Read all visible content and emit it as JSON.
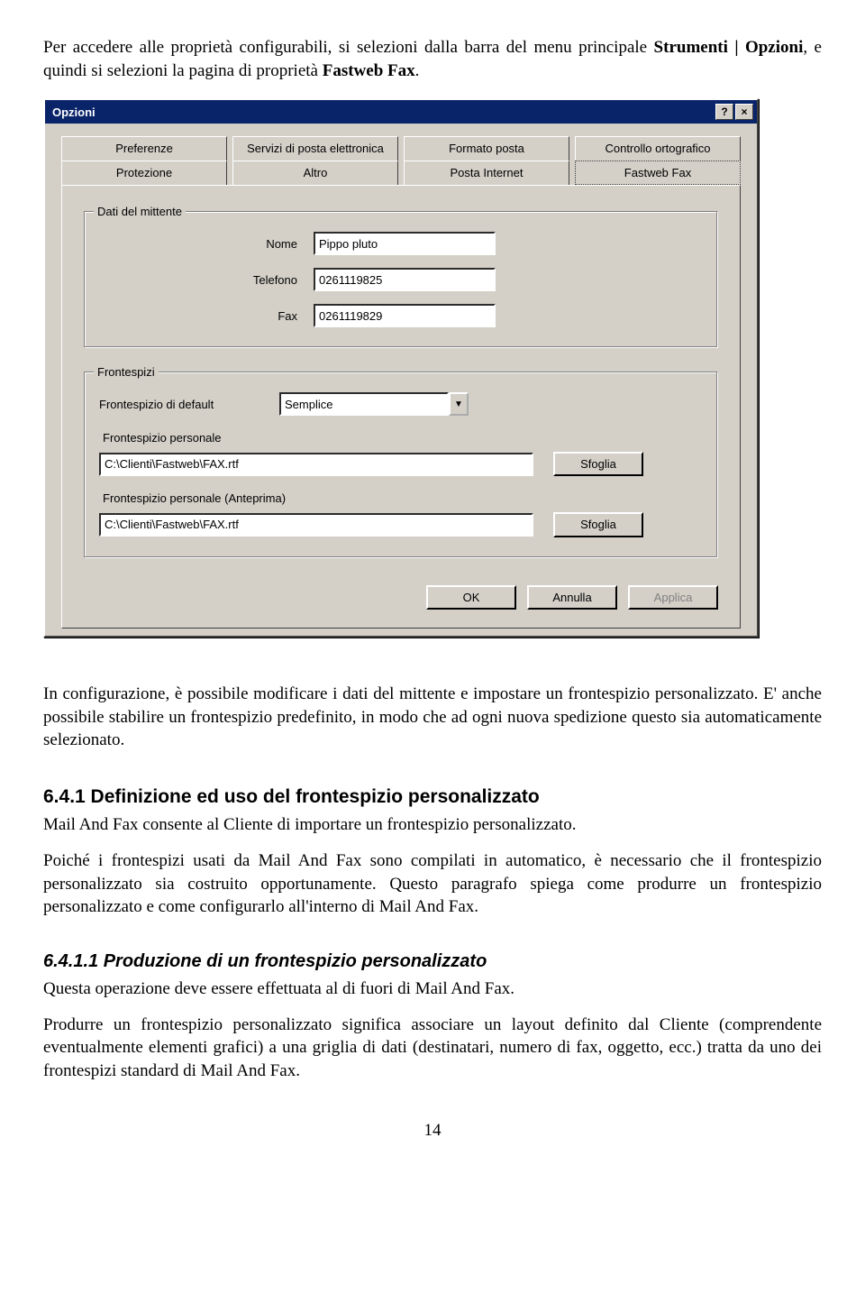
{
  "intro": {
    "p1_a": "Per accedere alle proprietà configurabili, si selezioni dalla barra del menu principale ",
    "p1_b": "Strumenti | Opzioni",
    "p1_c": ", e quindi si selezioni la pagina di proprietà ",
    "p1_d": "Fastweb Fax",
    "p1_e": "."
  },
  "dialog": {
    "title": "Opzioni",
    "help_glyph": "?",
    "close_glyph": "×",
    "tabs_top": [
      "Preferenze",
      "Servizi di posta elettronica",
      "Formato posta",
      "Controllo ortografico"
    ],
    "tabs_bottom": [
      "Protezione",
      "Altro",
      "Posta Internet",
      "Fastweb Fax"
    ],
    "group_sender": {
      "legend": "Dati del mittente",
      "name_label": "Nome",
      "name_value": "Pippo pluto",
      "phone_label": "Telefono",
      "phone_value": "0261119825",
      "fax_label": "Fax",
      "fax_value": "0261119829"
    },
    "group_front": {
      "legend": "Frontespizi",
      "default_label": "Frontespizio di default",
      "default_value": "Semplice",
      "personal_label": "Frontespizio personale",
      "personal_path": "C:\\Clienti\\Fastweb\\FAX.rtf",
      "preview_label": "Frontespizio personale (Anteprima)",
      "preview_path": "C:\\Clienti\\Fastweb\\FAX.rtf",
      "browse_label": "Sfoglia"
    },
    "buttons": {
      "ok": "OK",
      "cancel": "Annulla",
      "apply": "Applica"
    }
  },
  "body": {
    "p2": "In configurazione, è possibile modificare i dati del mittente e impostare un frontespizio personalizzato. E' anche possibile stabilire un frontespizio predefinito, in modo che ad ogni nuova spedizione questo sia automaticamente selezionato.",
    "h641": "6.4.1  Definizione ed uso del frontespizio personalizzato",
    "p3": "Mail And Fax consente al Cliente di importare un frontespizio personalizzato.",
    "p4": "Poiché i frontespizi usati da Mail And Fax sono compilati in automatico, è necessario che il frontespizio personalizzato sia costruito opportunamente. Questo paragrafo spiega come produrre un frontespizio personalizzato e come configurarlo all'interno di Mail And Fax.",
    "h6411": "6.4.1.1  Produzione di un frontespizio personalizzato",
    "p5": "Questa operazione deve essere effettuata al di fuori di Mail And Fax.",
    "p6": "Produrre un frontespizio personalizzato significa associare un layout definito dal Cliente (comprendente eventualmente elementi grafici) a una griglia di dati (destinatari, numero di fax, oggetto, ecc.) tratta da uno dei frontespizi standard di Mail And Fax.",
    "page_number": "14"
  }
}
